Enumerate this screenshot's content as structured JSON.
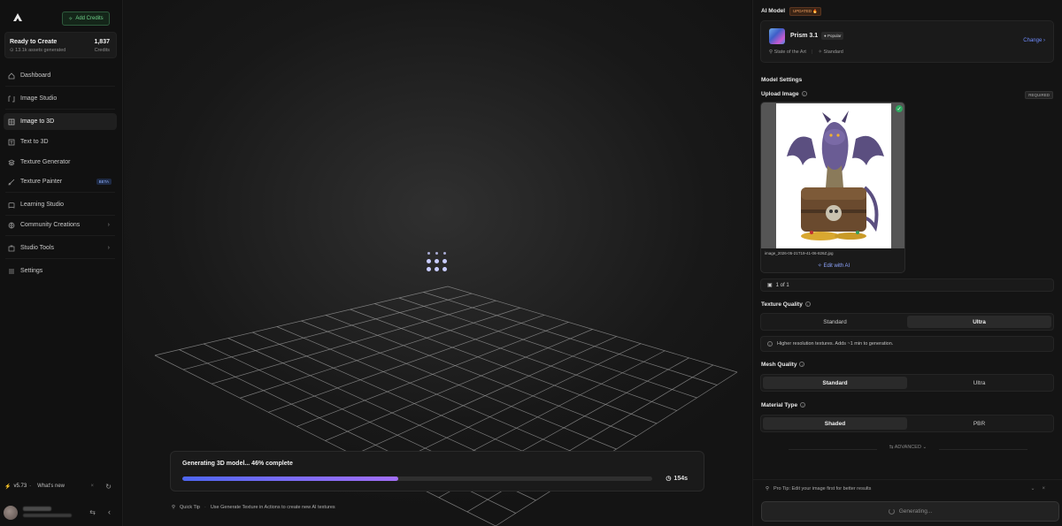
{
  "sidebar": {
    "add_credits": "Add Credits",
    "status": {
      "title": "Ready to Create",
      "assets": "13.1k assets generated",
      "credits_value": "1,837",
      "credits_label": "Credits"
    },
    "items": [
      {
        "label": "Dashboard",
        "icon": "home-icon"
      },
      {
        "label": "Image Studio",
        "icon": "image-studio-icon"
      },
      {
        "label": "Image to 3D",
        "icon": "cube-icon"
      },
      {
        "label": "Text to 3D",
        "icon": "text-icon"
      },
      {
        "label": "Texture Generator",
        "icon": "layers-icon"
      },
      {
        "label": "Texture Painter",
        "icon": "brush-icon",
        "badge": "BETA"
      },
      {
        "label": "Learning Studio",
        "icon": "book-icon"
      },
      {
        "label": "Community Creations",
        "icon": "globe-icon"
      },
      {
        "label": "Studio Tools",
        "icon": "tools-icon"
      },
      {
        "label": "Settings",
        "icon": "settings-icon"
      }
    ],
    "version": "v5.73",
    "whats_new": "What's new"
  },
  "viewport": {
    "progress_title": "Generating 3D model... 46% complete",
    "progress_fraction": 0.46,
    "elapsed": "154s",
    "quick_tip_label": "Quick Tip",
    "quick_tip_text": "Use Generate Texture in Actions to create new AI textures"
  },
  "panel": {
    "ai_model_label": "AI Model",
    "updated_badge": "UPDATED 🔥",
    "model": {
      "name": "Prism 3.1",
      "badge": "Popular",
      "tag1": "State of the Art",
      "tag2": "Standard",
      "change": "Change"
    },
    "model_settings": "Model Settings",
    "upload_label": "Upload Image",
    "required_badge": "REQUIRED",
    "filename": "image_2026-05-21T19-41-06-826Z.jpg",
    "edit_ai": "Edit with AI",
    "count": "1 of 1",
    "texture_quality": {
      "label": "Texture Quality",
      "options": [
        "Standard",
        "Ultra"
      ],
      "note": "Higher resolution textures. Adds ~1 min to generation."
    },
    "mesh_quality": {
      "label": "Mesh Quality",
      "options": [
        "Standard",
        "Ultra"
      ]
    },
    "material_type": {
      "label": "Material Type",
      "options": [
        "Shaded",
        "PBR"
      ]
    },
    "advanced": "ADVANCED",
    "pro_tip": "Pro Tip: Edit your image first for better results",
    "generate": "Generating..."
  },
  "colors": {
    "accent": "#6f8cff",
    "progress_start": "#4e66f0",
    "progress_end": "#a26ef6",
    "success": "#2fa860"
  }
}
